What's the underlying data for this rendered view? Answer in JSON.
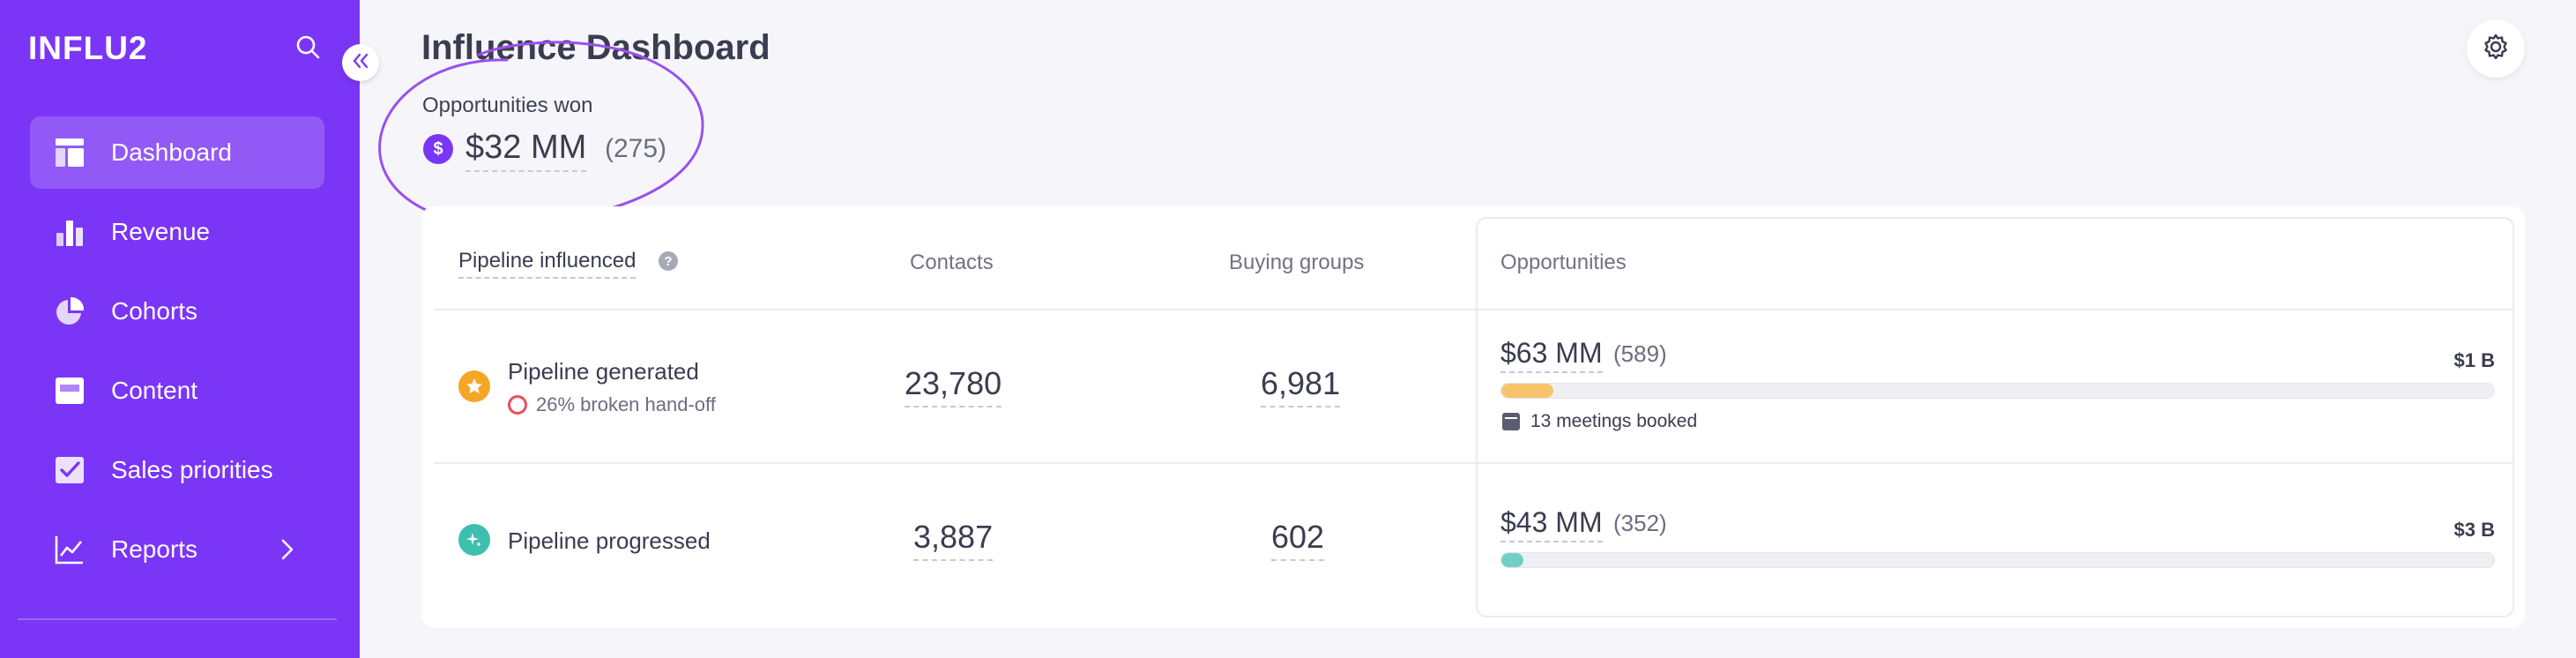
{
  "sidebar": {
    "logo": "INFLU2",
    "items": [
      {
        "label": "Dashboard",
        "icon": "dashboard-icon",
        "active": true
      },
      {
        "label": "Revenue",
        "icon": "bar-chart-icon"
      },
      {
        "label": "Cohorts",
        "icon": "pie-chart-icon"
      },
      {
        "label": "Content",
        "icon": "content-icon"
      },
      {
        "label": "Sales priorities",
        "icon": "checkbox-icon"
      },
      {
        "label": "Reports",
        "icon": "line-chart-icon",
        "has_submenu": true
      }
    ],
    "bg_color": "#7b35f6"
  },
  "header": {
    "title": "Influence Dashboard"
  },
  "won": {
    "label": "Opportunities won",
    "coin": "$",
    "value": "$32 MM",
    "count": "(275)"
  },
  "table": {
    "pipeline_header": "Pipeline influenced",
    "help": "?",
    "contacts_header": "Contacts",
    "groups_header": "Buying groups",
    "opps_header": "Opportunities",
    "rows": [
      {
        "title": "Pipeline generated",
        "subtitle": "26% broken hand-off",
        "contacts": "23,780",
        "groups": "6,981",
        "opp_value": "$63 MM",
        "opp_count": "(589)",
        "opp_total": "$1 B",
        "bar_fraction": 0.052,
        "bar_color": "#f7c46c",
        "meetings": "13 meetings booked",
        "icon_color": "#f5a623"
      },
      {
        "title": "Pipeline progressed",
        "contacts": "3,887",
        "groups": "602",
        "opp_value": "$43 MM",
        "opp_count": "(352)",
        "opp_total": "$3 B",
        "bar_fraction": 0.022,
        "bar_color": "#6fcfc6",
        "icon_color": "#3dbfae"
      }
    ]
  }
}
